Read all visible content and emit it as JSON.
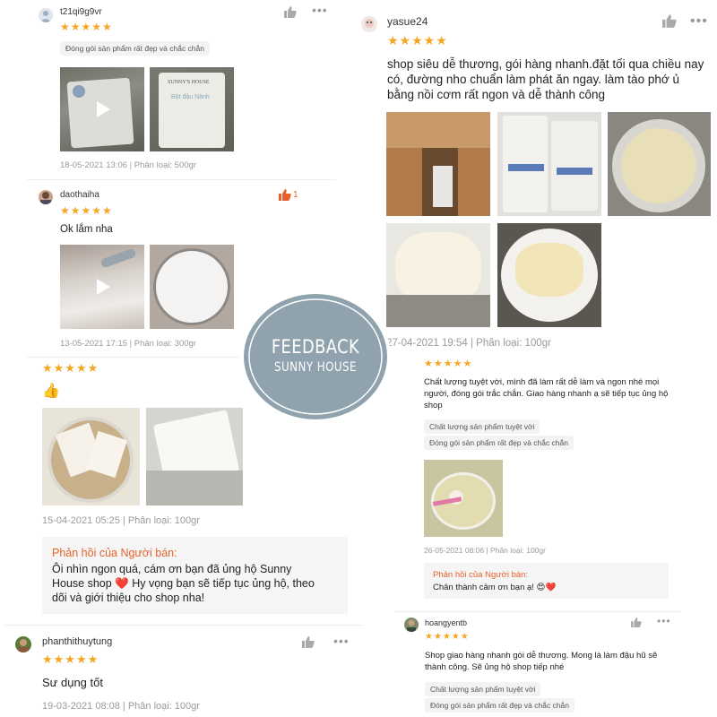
{
  "badge": {
    "line1": "FEEDBACK",
    "line2": "SUNNY HOUSE"
  },
  "colors": {
    "star": "#f5a623",
    "badge_fill": "#8fa2ad",
    "reply_header": "#e8612c",
    "heart": "#d9252b"
  },
  "reviews": [
    {
      "username": "t21qi9g9vr",
      "stars": 5,
      "tags": [
        "Đóng gói sản phẩm rất đẹp và chắc chắn"
      ],
      "meta": "18-05-2021 13:06 | Phân loại: 500gr",
      "package_label": "SUNNY'S HOUSE",
      "package_sub": "Bột đậu Nành"
    },
    {
      "username": "daothaiha",
      "stars": 5,
      "likes": "1",
      "text": "Ok lắm nha",
      "meta": "13-05-2021 17:15 | Phân loại: 300gr"
    },
    {
      "stars": 5,
      "text": "👍",
      "meta": "15-04-2021 05:25 | Phân loại: 100gr",
      "reply_header": "Phản hồi của Người bán:",
      "reply_text": "Ôi nhìn ngon quá, cám ơn bạn đã ủng hộ Sunny House shop ❤️ Hy vọng bạn sẽ tiếp tục ủng hộ, theo dõi và giới thiệu cho shop nha!"
    },
    {
      "username": "phanthithuytung",
      "stars": 5,
      "text": "Sư dụng tốt",
      "meta": "19-03-2021 08:08 | Phân loại: 100gr"
    },
    {
      "username": "yasue24",
      "stars": 5,
      "text": "shop siêu dễ thương, gói hàng nhanh.đặt tối qua chiều nay có, đường nho chuẩn làm phát ăn ngay. làm tào phớ ủ bằng nồi cơm rất ngon và dễ thành công",
      "meta": "27-04-2021 19:54 | Phân loại: 100gr"
    },
    {
      "stars": 5,
      "text": "Chất lượng tuyệt vời, mình đã làm rất dễ làm và ngon nhé mọi người, đóng gói trắc chắn. Giao hàng nhanh ạ sẽ tiếp tục ủng hộ shop",
      "tags": [
        "Chất lượng sản phẩm tuyệt vời",
        "Đóng gói sản phẩm rất đẹp và chắc chắn"
      ],
      "meta": "26-05-2021 08:06 | Phân loại: 100gr",
      "reply_header": "Phản hồi của Người bán:",
      "reply_text": "Chân thành cảm ơn bạn ạ! 😍❤️"
    },
    {
      "username": "hoangyentb",
      "stars": 5,
      "text": "Shop giao hàng nhanh gói dễ thương. Mong là làm đậu hũ sẽ thành công. Sẽ ủng hộ shop tiếp nhé",
      "tags": [
        "Chất lượng sản phẩm tuyệt vời",
        "Đóng gói sản phẩm rất đẹp và chắc chắn"
      ]
    }
  ],
  "icons": {
    "like": "thumbs-up-icon",
    "more": "more-options-icon",
    "play": "play-icon",
    "star": "star-icon"
  }
}
